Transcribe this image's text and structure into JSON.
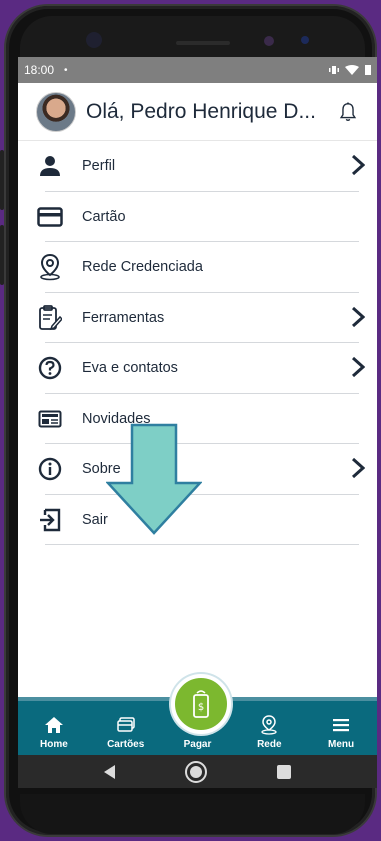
{
  "status_bar": {
    "time": "18:00",
    "dot": "•"
  },
  "header": {
    "greeting": "Olá, Pedro Henrique D..."
  },
  "menu": {
    "items": [
      {
        "label": "Perfil",
        "icon": "person-icon",
        "has_chevron": true
      },
      {
        "label": "Cartão",
        "icon": "card-icon",
        "has_chevron": false
      },
      {
        "label": "Rede Credenciada",
        "icon": "location-pin-icon",
        "has_chevron": false
      },
      {
        "label": "Ferramentas",
        "icon": "clipboard-edit-icon",
        "has_chevron": true
      },
      {
        "label": "Eva e contatos",
        "icon": "help-circle-icon",
        "has_chevron": true
      },
      {
        "label": "Novidades",
        "icon": "news-icon",
        "has_chevron": false
      },
      {
        "label": "Sobre",
        "icon": "info-icon",
        "has_chevron": true
      },
      {
        "label": "Sair",
        "icon": "logout-icon",
        "has_chevron": false
      }
    ]
  },
  "bottom_nav": {
    "home": "Home",
    "cards": "Cartões",
    "pay": "Pagar",
    "network": "Rede",
    "menu": "Menu"
  },
  "colors": {
    "primary_dark": "#1e2a3a",
    "nav_teal": "#0a6a7e",
    "pay_green": "#7cb82f",
    "overlay_arrow": "#7ecfc6",
    "background_purple": "#5a2a82"
  }
}
